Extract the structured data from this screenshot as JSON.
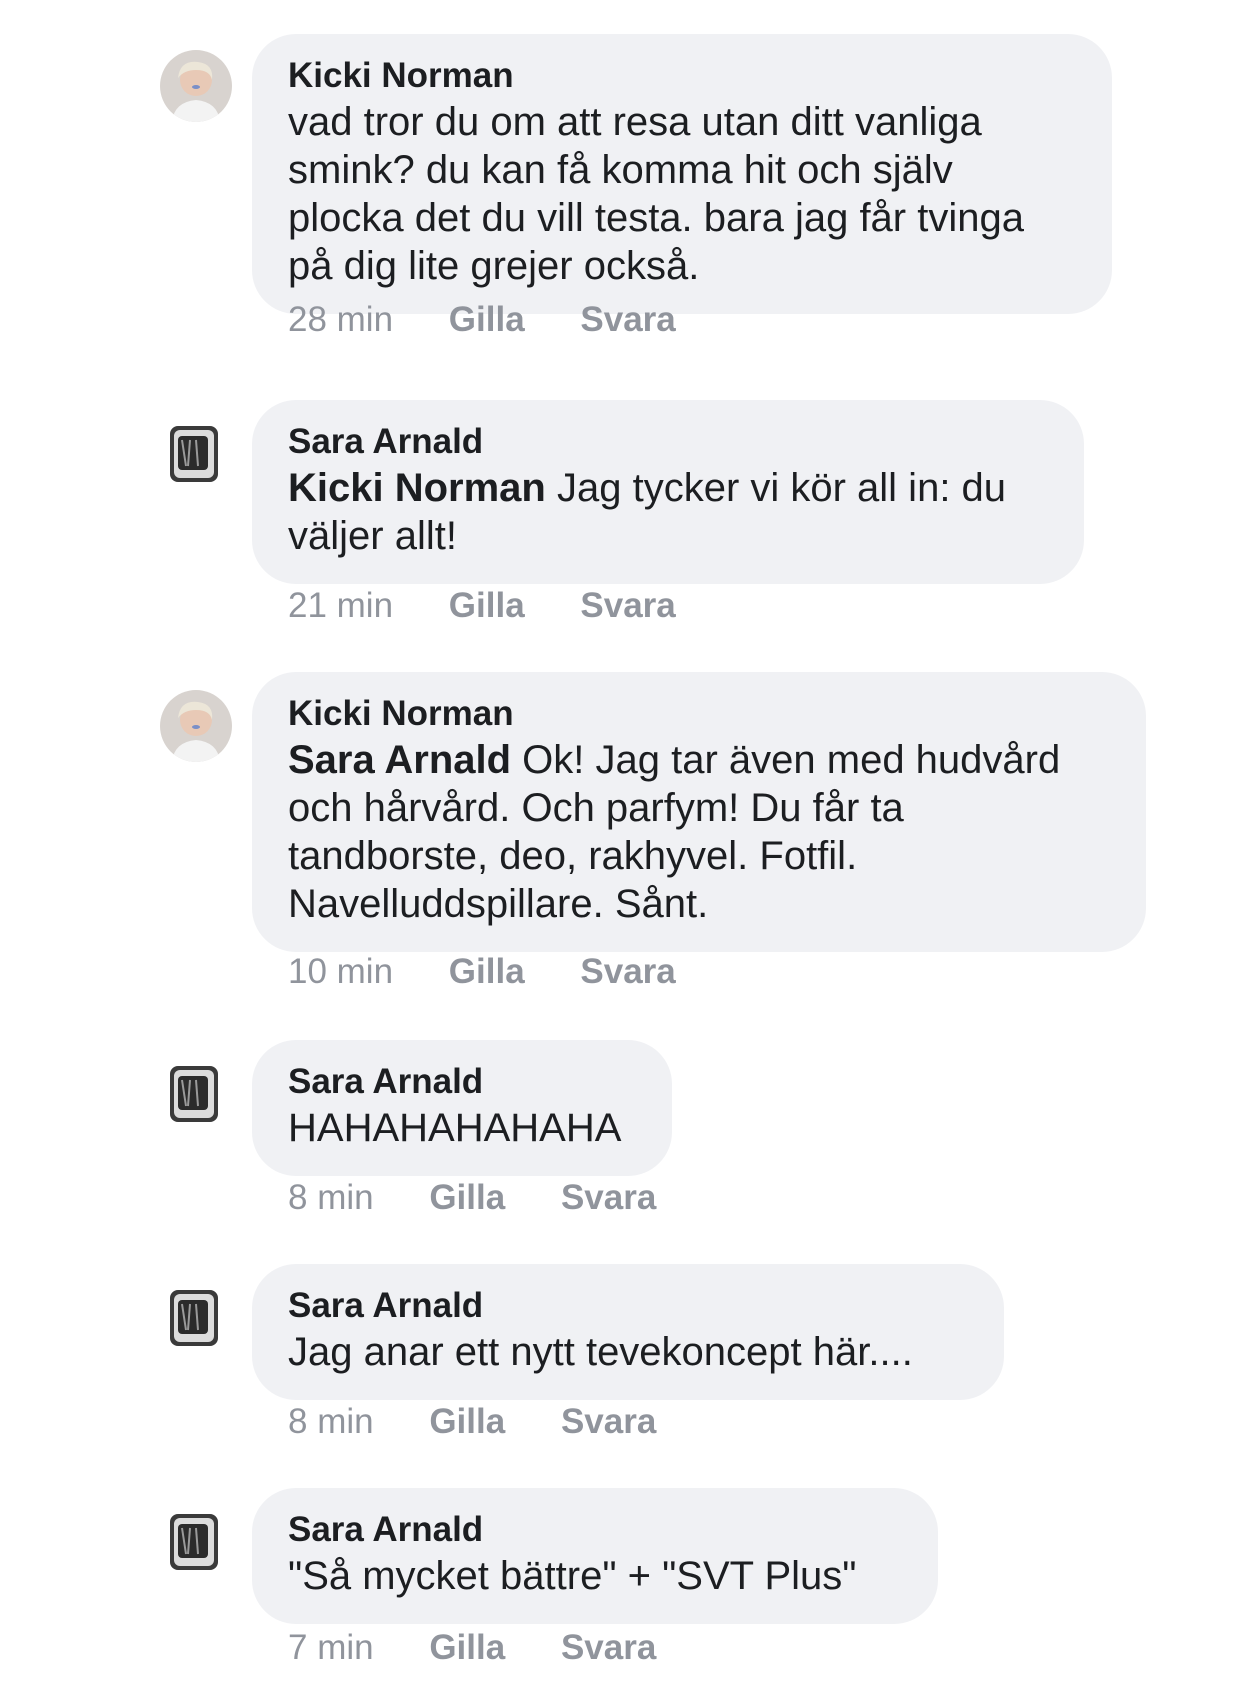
{
  "actions": {
    "like_label": "Gilla",
    "reply_label": "Svara"
  },
  "comments": [
    {
      "author": "Kicki Norman",
      "mention": "",
      "text": "vad tror du om att resa utan ditt vanliga smink? du kan få komma hit och själv plocka det du vill testa. bara jag får tvinga på dig lite grejer också.",
      "time": "28 min",
      "avatar": "person-photo-icon"
    },
    {
      "author": "Sara Arnald",
      "mention": "Kicki Norman",
      "text": " Jag tycker vi kör all in: du väljer allt!",
      "time": "21 min",
      "avatar": "tv-set-icon"
    },
    {
      "author": "Kicki Norman",
      "mention": "Sara Arnald",
      "text": " Ok! Jag tar även med hudvård och hårvård. Och parfym! Du får ta tandborste, deo, rakhyvel. Fotfil. Navelluddspillare. Sånt.",
      "time": "10 min",
      "avatar": "person-photo-icon"
    },
    {
      "author": "Sara Arnald",
      "mention": "",
      "text": "HAHAHAHAHAHA",
      "time": "8 min",
      "avatar": "tv-set-icon"
    },
    {
      "author": "Sara Arnald",
      "mention": "",
      "text": "Jag anar ett nytt tevekoncept här....",
      "time": "8 min",
      "avatar": "tv-set-icon"
    },
    {
      "author": "Sara Arnald",
      "mention": "",
      "text": "\"Så mycket bättre\" + \"SVT Plus\"",
      "time": "7 min",
      "avatar": "tv-set-icon"
    }
  ]
}
